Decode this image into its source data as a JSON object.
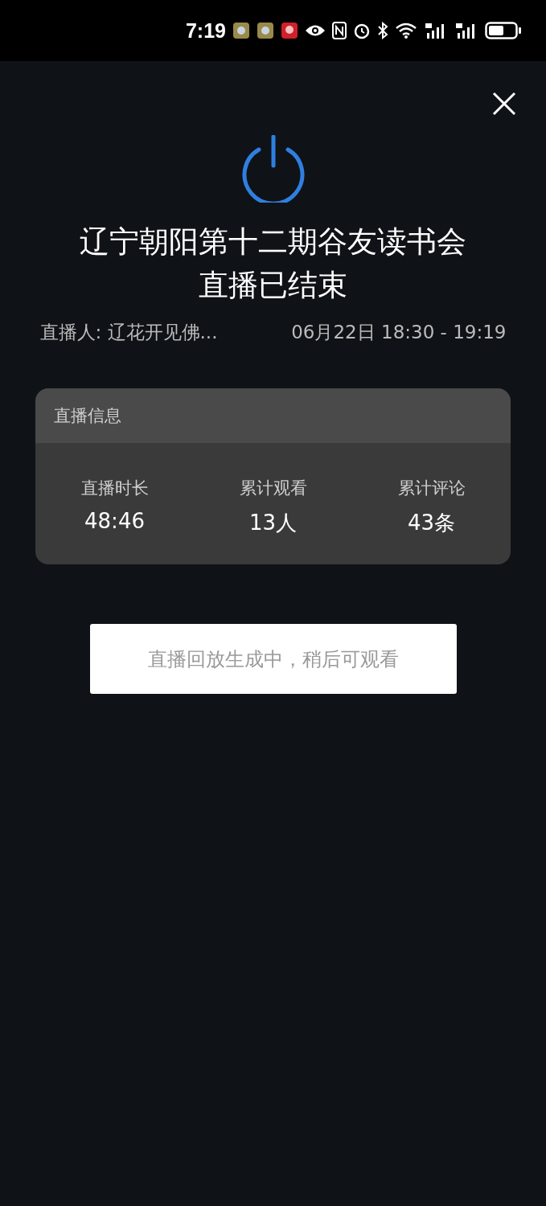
{
  "status_bar": {
    "time": "7:19"
  },
  "title_lines": [
    "辽宁朝阳第十二期谷友读书会",
    "直播已结束"
  ],
  "host": "直播人: 辽花开见佛...",
  "time_range": "06月22日 18:30 - 19:19",
  "info_card": {
    "title": "直播信息",
    "stats": [
      {
        "label": "直播时长",
        "value": "48:46"
      },
      {
        "label": "累计观看",
        "value": "13人"
      },
      {
        "label": "累计评论",
        "value": "43条"
      }
    ]
  },
  "replay_button": "直播回放生成中，稍后可观看"
}
